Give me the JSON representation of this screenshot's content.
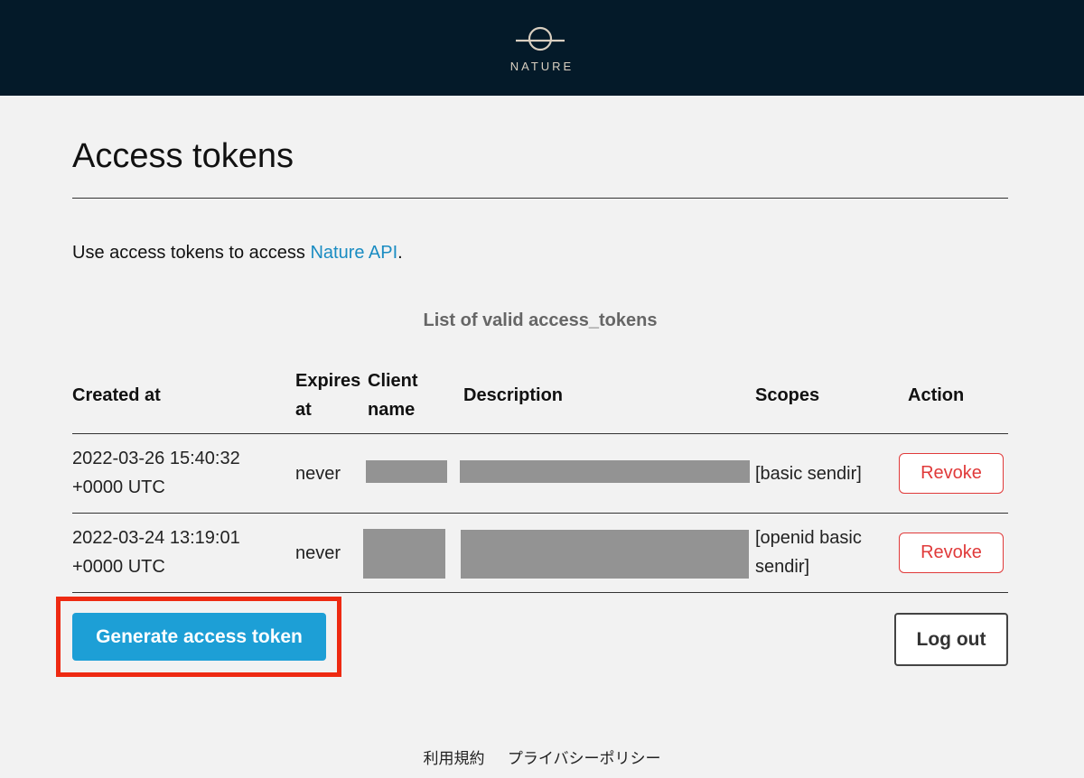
{
  "header": {
    "logo_text": "NATURE"
  },
  "page": {
    "title": "Access tokens"
  },
  "intro": {
    "prefix": "Use access tokens to access ",
    "link_text": "Nature API",
    "suffix": "."
  },
  "table": {
    "caption": "List of valid access_tokens",
    "headers": {
      "created_at": "Created at",
      "expires_at_1": "Expires",
      "expires_at_2": "at",
      "client_name_1": "Client",
      "client_name_2": "name",
      "description": "Description",
      "scopes": "Scopes",
      "action": "Action"
    },
    "rows": [
      {
        "created_line1": "2022-03-26 15:40:32",
        "created_line2": "+0000 UTC",
        "expires": "never",
        "scopes_line1": "[basic sendir]",
        "scopes_line2": "",
        "action": "Revoke"
      },
      {
        "created_line1": "2022-03-24 13:19:01",
        "created_line2": "+0000 UTC",
        "expires": "never",
        "scopes_line1": "[openid basic",
        "scopes_line2": "sendir]",
        "action": "Revoke"
      }
    ]
  },
  "actions": {
    "generate": "Generate access token",
    "logout": "Log out"
  },
  "footer": {
    "terms": "利用規約",
    "privacy": "プライバシーポリシー"
  },
  "colors": {
    "header_bg": "#041a29",
    "accent": "#1d9fd6",
    "danger": "#e03a3a",
    "highlight": "#ee2a12"
  }
}
